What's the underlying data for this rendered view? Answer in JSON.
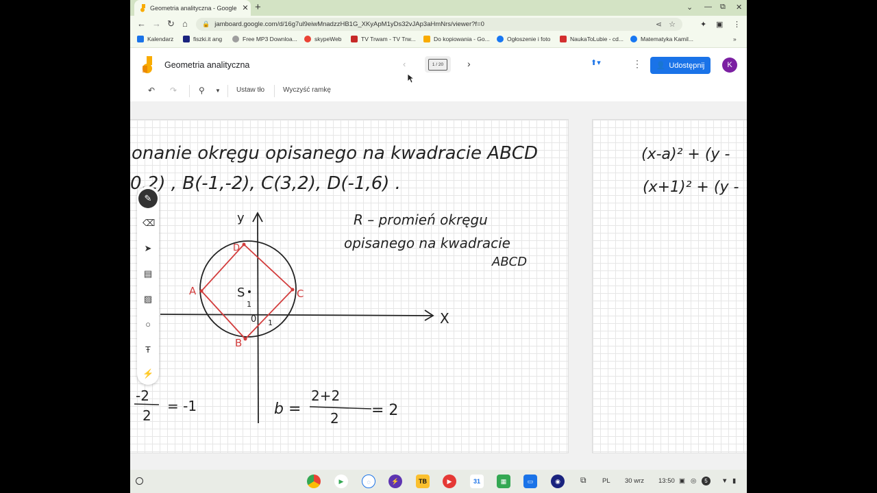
{
  "browser": {
    "tab_title": "Geometria analityczna - Google",
    "tab_close": "✕",
    "new_tab": "+",
    "url": "jamboard.google.com/d/16g7ul9eiwMnadzzHB1G_XKyApM1yDs32vJAp3aHmNrs/viewer?f=0",
    "window_controls": {
      "chevron": "⌄",
      "minimize": "—",
      "maximize": "⧉",
      "close": "✕"
    }
  },
  "bookmarks": [
    {
      "label": "Kalendarz",
      "color": "#1a73e8"
    },
    {
      "label": "fiszki.it ang",
      "color": "#1a237e"
    },
    {
      "label": "Free MP3 Downloa...",
      "color": "#9e9e9e"
    },
    {
      "label": "skypeWeb",
      "color": "#ea4335"
    },
    {
      "label": "TV Trwam - TV Trw...",
      "color": "#c62828"
    },
    {
      "label": "Do kopiowania - Go...",
      "color": "#f9ab00"
    },
    {
      "label": "Ogłoszenie i foto",
      "color": "#1877f2"
    },
    {
      "label": "NaukaToLubie - cd...",
      "color": "#d32f2f"
    },
    {
      "label": "Matematyka Kamil...",
      "color": "#1877f2"
    }
  ],
  "bookmarks_more": "»",
  "jamboard": {
    "title": "Geometria analityczna",
    "frame_indicator": "1 / 20",
    "share_label": "Udostępnij",
    "avatar_letter": "K",
    "tools": {
      "set_background": "Ustaw tło",
      "clear_frame": "Wyczyść ramkę"
    }
  },
  "handwriting": {
    "line1": "onanie okręgu opisanego na kwadracie ABCD",
    "line2": "0,2) , B(-1,-2), C(3,2), D(-1,6) .",
    "note1": "R – promień okręgu",
    "note2": "opisanego na kwadracie",
    "note3": "ABCD",
    "axis_x": "X",
    "axis_y": "y",
    "pt_A": "A",
    "pt_B": "B",
    "pt_C": "C",
    "pt_D": "D",
    "pt_S": "S",
    "tick_1a": "1",
    "tick_1b": "1",
    "origin": "0",
    "frac_left_num": "-2",
    "frac_left_den": "2",
    "frac_left_res": "= -1",
    "b_eq": "b =",
    "frac_right_num": "2+2",
    "frac_right_den": "2",
    "frac_right_res": "= 2",
    "frame2_line1": "(x-a)² + (y -",
    "frame2_line2": "(x+1)² + (y -"
  },
  "shelf": {
    "language": "PL",
    "date": "30 wrz",
    "time": "13:50",
    "badge": "5"
  }
}
